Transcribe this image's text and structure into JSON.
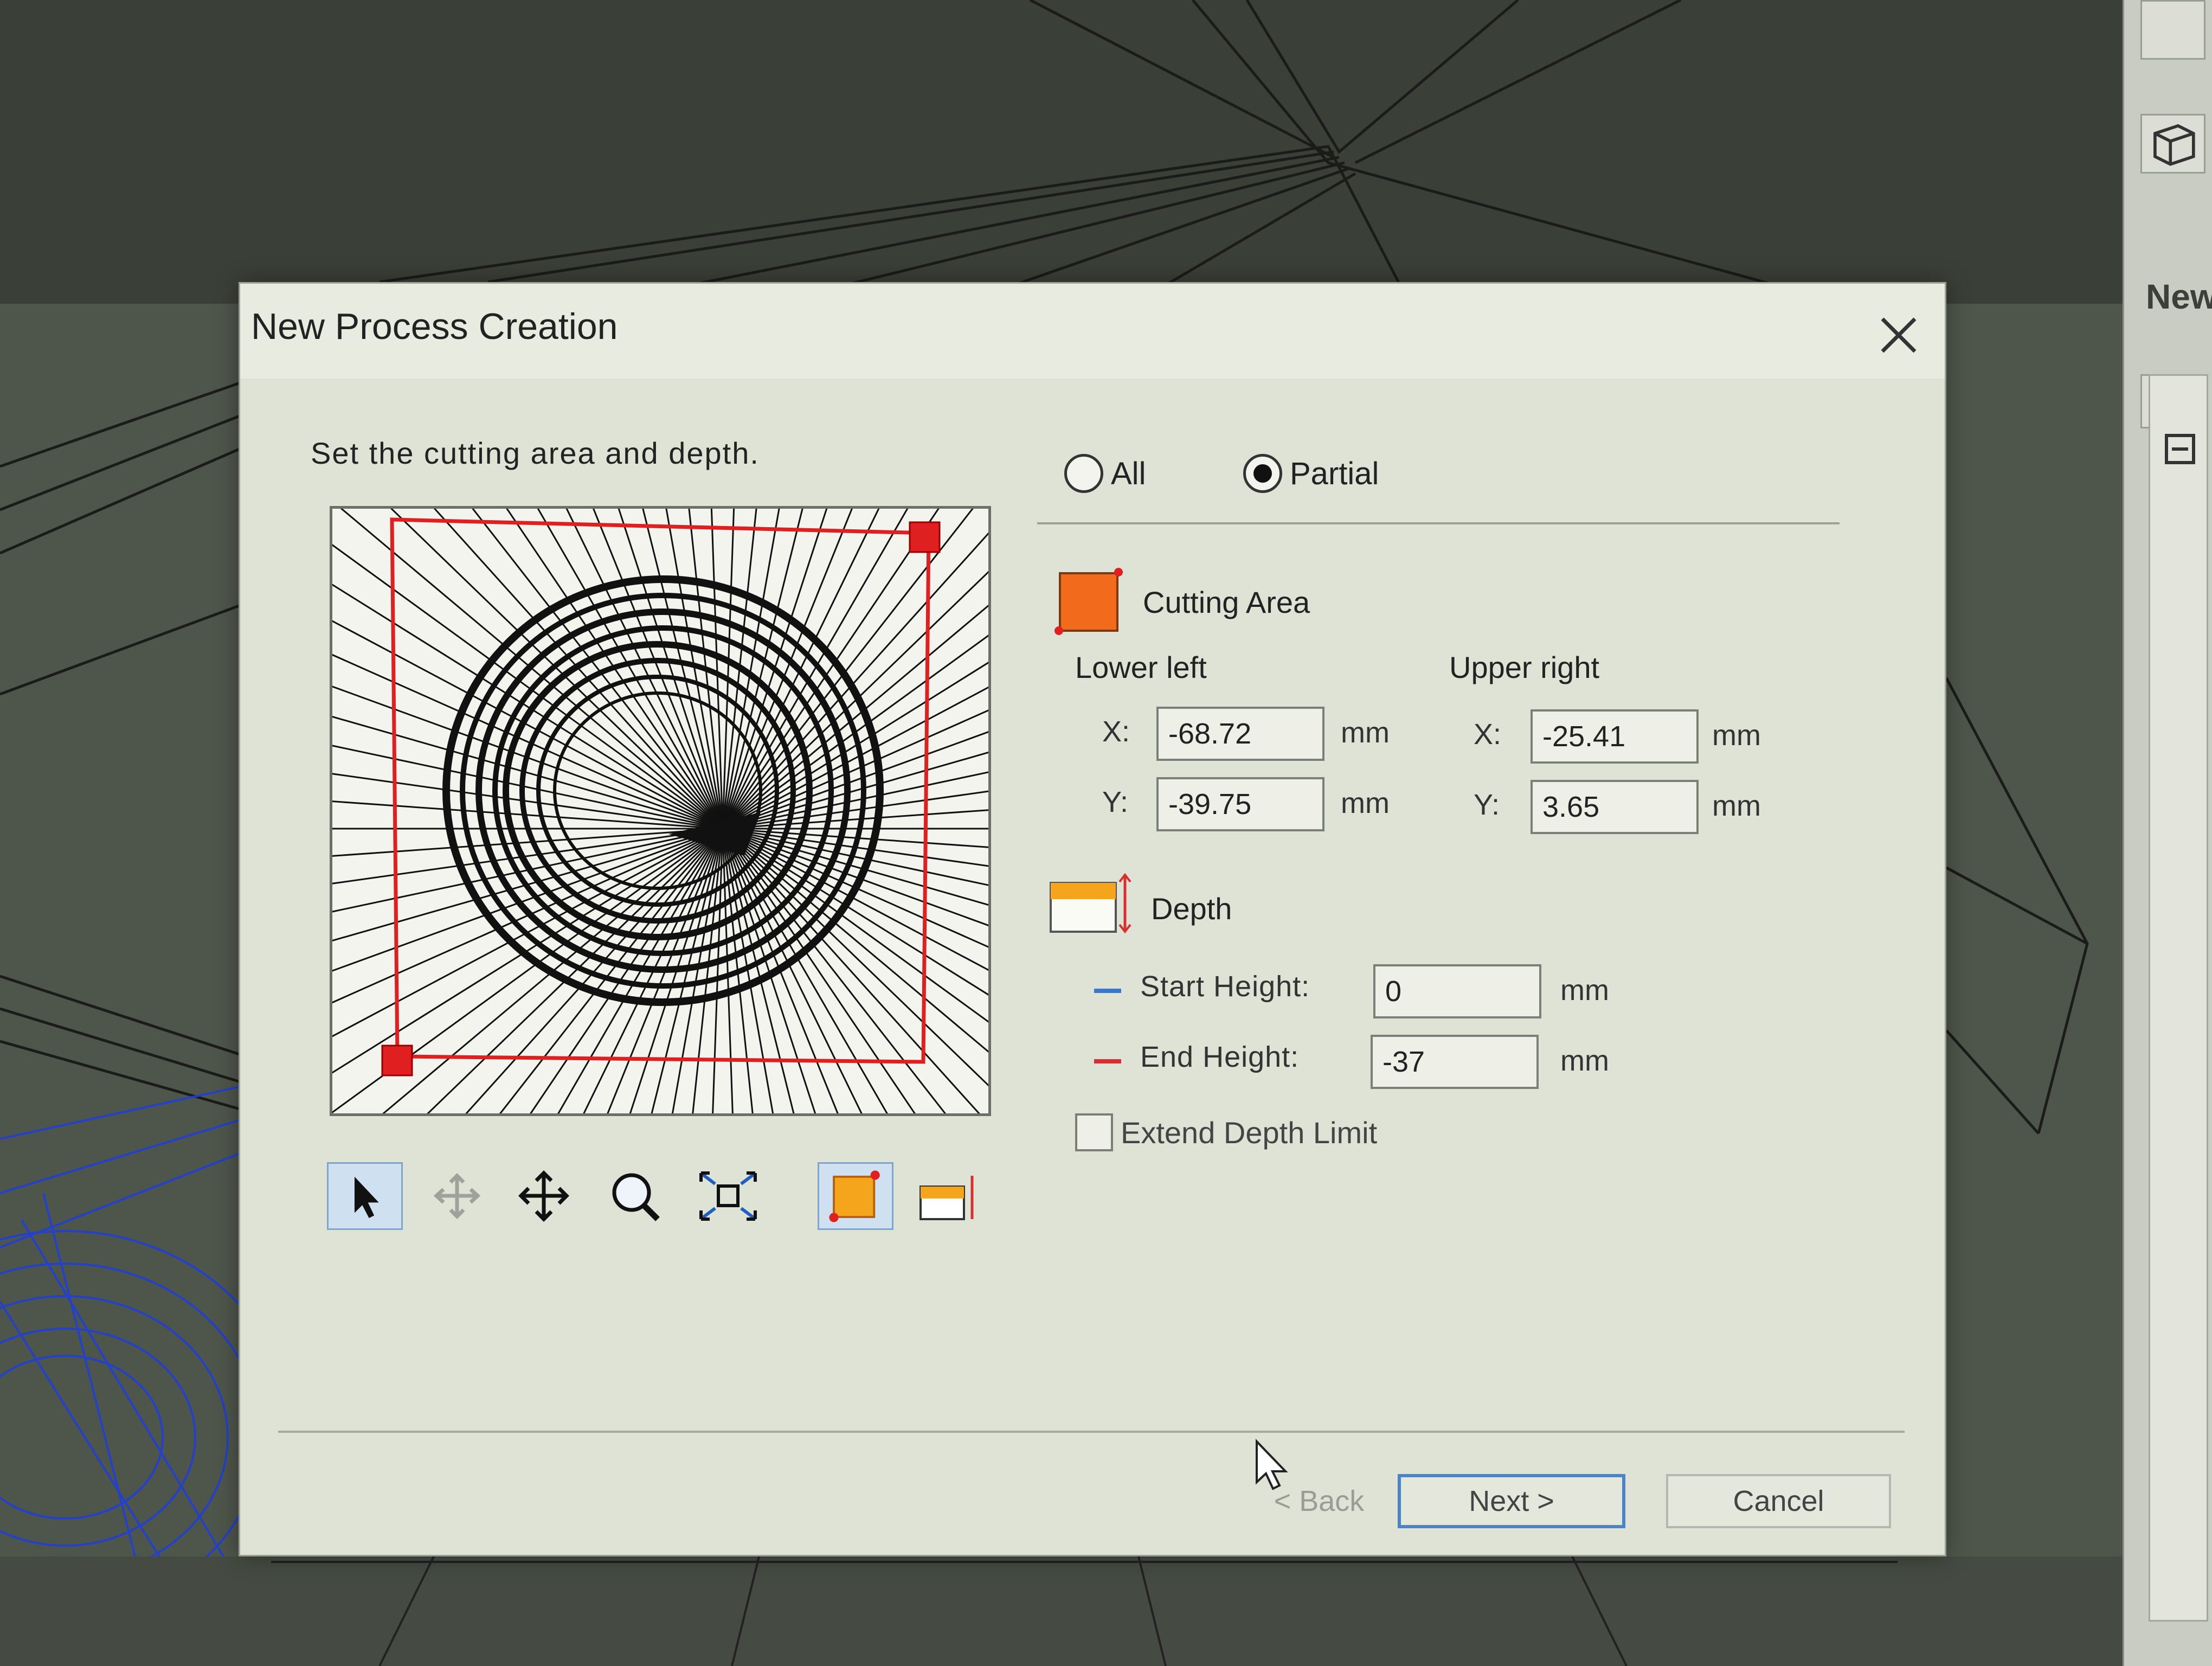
{
  "dialog": {
    "title": "New Process Creation",
    "instruction": "Set the cutting area and depth."
  },
  "scope": {
    "options": [
      {
        "label": "All",
        "selected": false
      },
      {
        "label": "Partial",
        "selected": true
      }
    ]
  },
  "cutting_area": {
    "label": "Cutting Area",
    "lower_left": {
      "label": "Lower left",
      "x_label": "X:",
      "y_label": "Y:",
      "x": "-68.72",
      "y": "-39.75",
      "unit": "mm"
    },
    "upper_right": {
      "label": "Upper right",
      "x_label": "X:",
      "y_label": "Y:",
      "x": "-25.41",
      "y": "3.65",
      "unit": "mm"
    }
  },
  "depth": {
    "label": "Depth",
    "start_height": {
      "label": "Start Height:",
      "value": "0",
      "unit": "mm"
    },
    "end_height": {
      "label": "End Height:",
      "value": "-37",
      "unit": "mm"
    },
    "extend_limit": {
      "label": "Extend Depth Limit",
      "checked": false
    }
  },
  "toolbar": {
    "tools": [
      "select-arrow-icon",
      "pan-disabled-icon",
      "move-icon",
      "zoom-icon",
      "fit-view-icon",
      "cutting-area-icon",
      "depth-icon"
    ],
    "active": "select-arrow-icon"
  },
  "buttons": {
    "back": "< Back",
    "next": "Next >",
    "cancel": "Cancel"
  },
  "side_panel": {
    "label": "New"
  },
  "colors": {
    "selection_red": "#e02020",
    "area_orange": "#f26a1b",
    "focus_blue": "#4f84c4",
    "start_blue": "#3a78d0",
    "end_red": "#d83030"
  }
}
